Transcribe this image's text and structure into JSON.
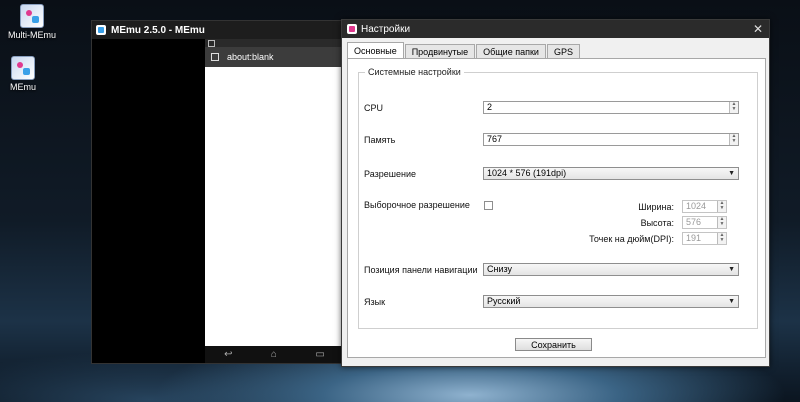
{
  "desktop": {
    "icons": [
      {
        "label": "Multi-MEmu"
      },
      {
        "label": "MEmu"
      }
    ]
  },
  "memu_window": {
    "title": "MEmu 2.5.0 - MEmu",
    "browser": {
      "url": "about:blank"
    },
    "nav_buttons": [
      "↩",
      "⌂",
      "▭"
    ]
  },
  "settings": {
    "title": "Настройки",
    "close_glyph": "✕",
    "tabs": [
      "Основные",
      "Продвинутые",
      "Общие папки",
      "GPS"
    ],
    "active_tab": "Основные",
    "group_title": "Системные настройки",
    "cpu": {
      "label": "CPU",
      "value": "2"
    },
    "memory": {
      "label": "Память",
      "value": "767"
    },
    "resolution": {
      "label": "Разрешение",
      "value": "1024 * 576 (191dpi)"
    },
    "custom_resolution": {
      "label": "Выборочное разрешение",
      "checked": false,
      "width_label": "Ширина:",
      "width_value": "1024",
      "height_label": "Высота:",
      "height_value": "576",
      "dpi_label": "Точек на дюйм(DPI):",
      "dpi_value": "191"
    },
    "navbar_position": {
      "label": "Позиция панели навигации",
      "value": "Снизу"
    },
    "language": {
      "label": "Язык",
      "value": "Русский"
    },
    "save_label": "Сохранить"
  }
}
